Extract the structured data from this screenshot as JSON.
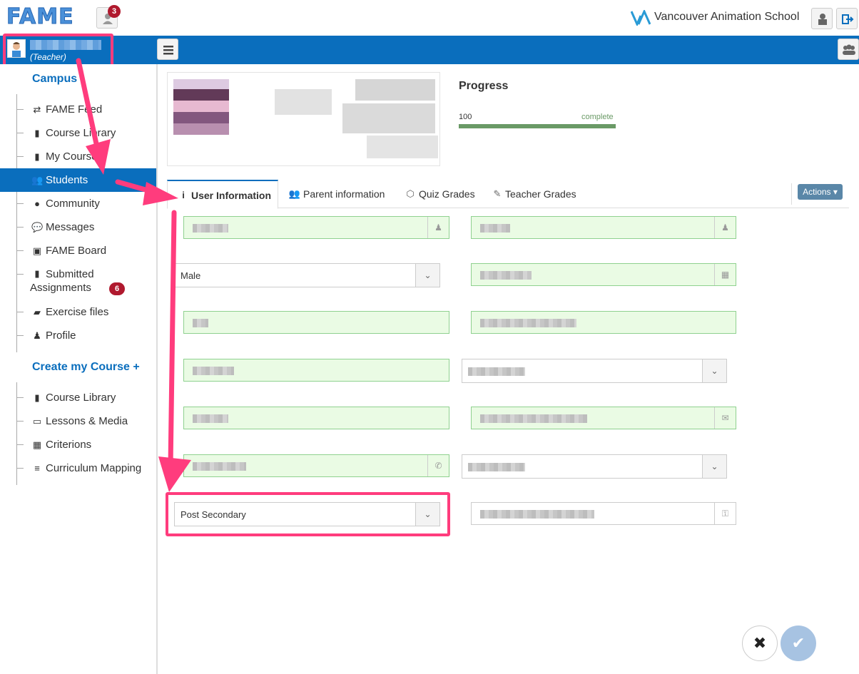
{
  "header": {
    "logo_text": "FAME",
    "notification_count": "3",
    "school_name": "Vancouver Animation School"
  },
  "user": {
    "role": "(Teacher)"
  },
  "sidebar": {
    "campus_title": "Campus",
    "campus_items": [
      {
        "label": "FAME Feed",
        "icon": "retweet-icon"
      },
      {
        "label": "Course Library",
        "icon": "book-icon"
      },
      {
        "label": "My Courses",
        "icon": "book-icon"
      },
      {
        "label": "Students",
        "icon": "users-icon",
        "active": true
      },
      {
        "label": "Community",
        "icon": "globe-icon"
      },
      {
        "label": "Messages",
        "icon": "comment-icon"
      },
      {
        "label": "FAME Board",
        "icon": "picture-icon"
      },
      {
        "label": "Submitted Assignments",
        "icon": "book-icon",
        "badge": "6"
      },
      {
        "label": "Exercise files",
        "icon": "folder-open-icon"
      },
      {
        "label": "Profile",
        "icon": "user-icon"
      }
    ],
    "create_title": "Create my Course +",
    "create_items": [
      {
        "label": "Course Library",
        "icon": "book-icon"
      },
      {
        "label": "Lessons & Media",
        "icon": "monitor-icon"
      },
      {
        "label": "Criterions",
        "icon": "table-icon"
      },
      {
        "label": "Curriculum Mapping",
        "icon": "list-icon"
      }
    ]
  },
  "progress": {
    "title": "Progress",
    "value": "100",
    "complete_label": "complete",
    "fraction": 1.0
  },
  "tabs": [
    {
      "label": "User Information",
      "icon": "info-icon",
      "active": true
    },
    {
      "label": "Parent information",
      "icon": "users-icon"
    },
    {
      "label": "Quiz Grades",
      "icon": "cubes-icon"
    },
    {
      "label": "Teacher Grades",
      "icon": "edit-icon"
    }
  ],
  "actions_label": "Actions",
  "form": {
    "gender_value": "Male",
    "level_value": "Post Secondary"
  },
  "colors": {
    "brand_blue": "#0a6ebd",
    "highlight_pink": "#ff3c7d",
    "valid_green": "#eafbe4",
    "badge_red": "#b0192e"
  }
}
